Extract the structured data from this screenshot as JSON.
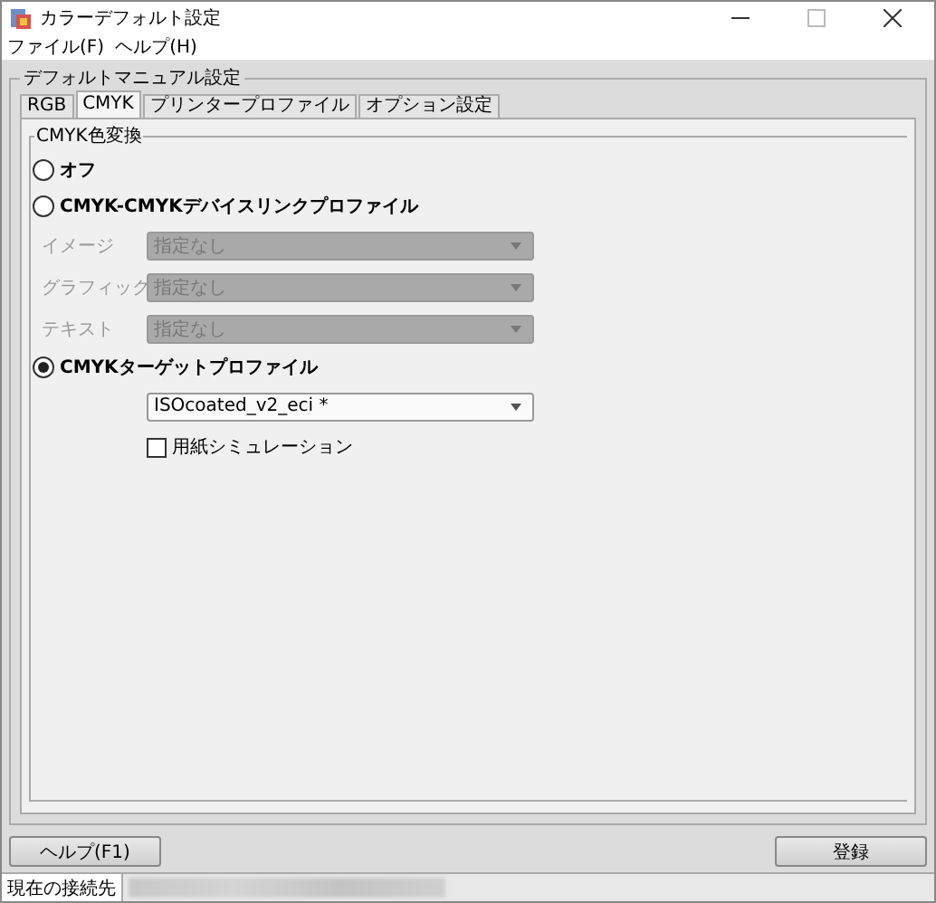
{
  "window": {
    "title": "カラーデフォルト設定"
  },
  "menu": [
    {
      "label": "ファイル(F)"
    },
    {
      "label": "ヘルプ(H)"
    }
  ],
  "group": {
    "title": "デフォルトマニュアル設定"
  },
  "tabs": [
    {
      "label": "RGB",
      "selected": false
    },
    {
      "label": "CMYK",
      "selected": true
    },
    {
      "label": "プリンタープロファイル",
      "selected": false
    },
    {
      "label": "オプション設定",
      "selected": false
    }
  ],
  "section": {
    "title": "CMYK色変換"
  },
  "options": [
    {
      "kind": "radio",
      "label": "オフ",
      "selected": false
    },
    {
      "kind": "radio",
      "label": "CMYK-CMYKデバイスリンクプロファイル",
      "selected": false
    },
    {
      "kind": "dropdown",
      "label": "イメージ",
      "value": "指定なし",
      "disabled": true
    },
    {
      "kind": "dropdown",
      "label": "グラフィック",
      "value": "指定なし",
      "disabled": true
    },
    {
      "kind": "dropdown",
      "label": "テキスト",
      "value": "指定なし",
      "disabled": true
    },
    {
      "kind": "radio",
      "label": "CMYKターゲットプロファイル",
      "selected": true
    },
    {
      "kind": "dropdown",
      "value": "ISOcoated_v2_eci *",
      "disabled": false
    },
    {
      "kind": "checkbox",
      "label": "用紙シミュレーション",
      "checked": false
    }
  ],
  "buttons": [
    {
      "label": "ヘルプ(F1)"
    },
    {
      "label": "登録"
    }
  ],
  "status_bar": {
    "label": "現在の接続先"
  }
}
